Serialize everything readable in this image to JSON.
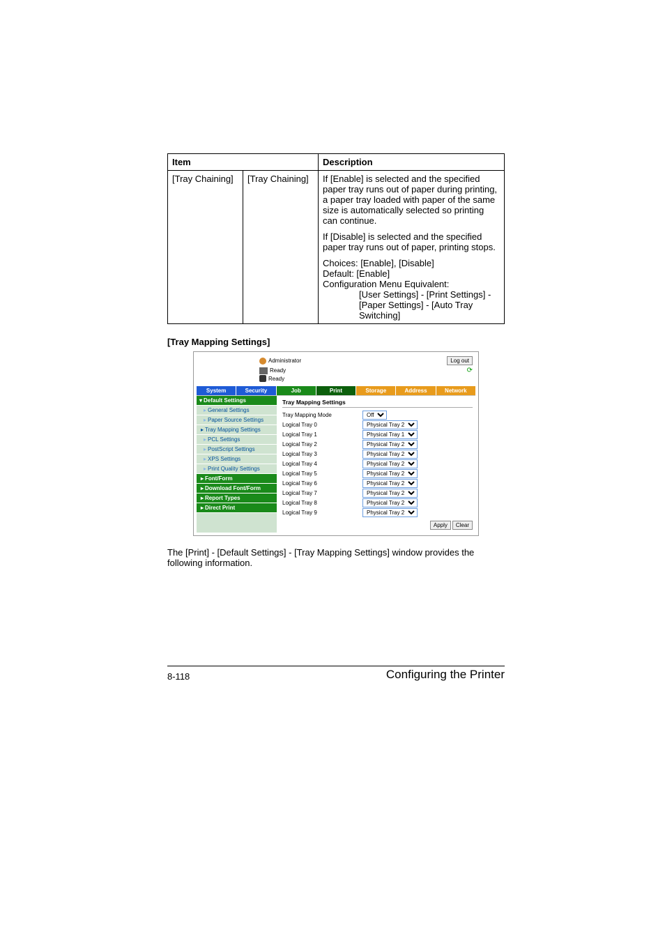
{
  "table": {
    "headers": {
      "item": "Item",
      "description": "Description"
    },
    "row": {
      "item_a": "[Tray Chaining]",
      "item_b": "[Tray Chaining]",
      "desc_p1": "If [Enable] is selected and the specified paper tray runs out of paper during printing, a paper tray loaded with paper of the same size is automatically selected so printing can continue.",
      "desc_p2": "If [Disable] is selected and the specified paper tray runs out of paper, printing stops.",
      "desc_choices": "Choices: [Enable], [Disable]",
      "desc_default": "Default:  [Enable]",
      "desc_cfg": "Configuration Menu Equivalent:",
      "desc_cfg_line1": "[User Settings] - [Print Settings] -",
      "desc_cfg_line2": "[Paper Settings] - [Auto Tray",
      "desc_cfg_line3": "Switching]"
    }
  },
  "section_heading": "[Tray Mapping Settings]",
  "ui": {
    "admin_label": "Administrator",
    "logout": "Log out",
    "status1": "Ready",
    "status2": "Ready",
    "tabs": {
      "system": "System",
      "security": "Security",
      "job": "Job",
      "print": "Print",
      "storage": "Storage",
      "address": "Address",
      "network": "Network"
    },
    "nav": {
      "default_settings": "Default Settings",
      "general": "General Settings",
      "paper_source": "Paper Source Settings",
      "tray_mapping": "Tray Mapping Settings",
      "pcl": "PCL Settings",
      "postscript": "PostScript Settings",
      "xps": "XPS Settings",
      "print_quality": "Print Quality Settings",
      "font_form": "Font/Form",
      "download_font_form": "Download Font/Form",
      "report_types": "Report Types",
      "direct_print": "Direct Print"
    },
    "content": {
      "title": "Tray Mapping Settings",
      "mode_label": "Tray Mapping Mode",
      "mode_value": "Off",
      "rows": [
        {
          "label": "Logical Tray 0",
          "value": "Physical Tray 2"
        },
        {
          "label": "Logical Tray 1",
          "value": "Physical Tray 1"
        },
        {
          "label": "Logical Tray 2",
          "value": "Physical Tray 2"
        },
        {
          "label": "Logical Tray 3",
          "value": "Physical Tray 2"
        },
        {
          "label": "Logical Tray 4",
          "value": "Physical Tray 2"
        },
        {
          "label": "Logical Tray 5",
          "value": "Physical Tray 2"
        },
        {
          "label": "Logical Tray 6",
          "value": "Physical Tray 2"
        },
        {
          "label": "Logical Tray 7",
          "value": "Physical Tray 2"
        },
        {
          "label": "Logical Tray 8",
          "value": "Physical Tray 2"
        },
        {
          "label": "Logical Tray 9",
          "value": "Physical Tray 2"
        }
      ],
      "apply": "Apply",
      "clear": "Clear"
    }
  },
  "body_text": "The [Print] - [Default Settings] - [Tray Mapping Settings] window provides the following information.",
  "footer": {
    "page": "8-118",
    "section": "Configuring the Printer"
  }
}
